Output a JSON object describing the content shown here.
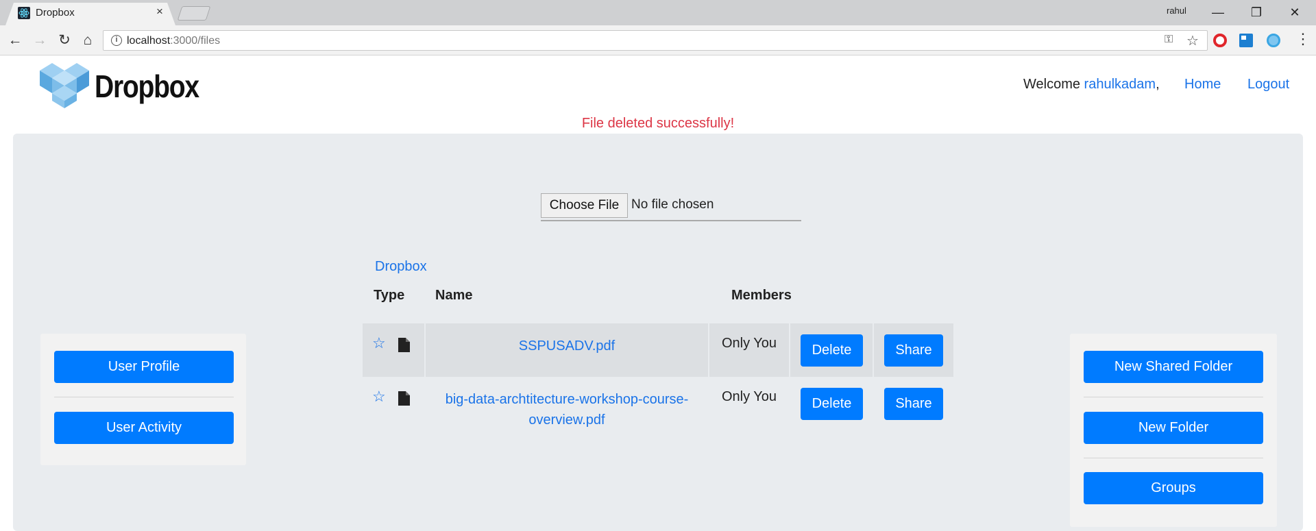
{
  "browser": {
    "tab_title": "Dropbox",
    "tab_close": "×",
    "window_user": "rahul",
    "window_controls": {
      "minimize": "—",
      "restore": "❐",
      "close": "✕"
    },
    "nav": {
      "back": "←",
      "forward": "→",
      "reload": "↻",
      "home": "⌂"
    },
    "url_host": "localhost",
    "url_path": ":3000/files",
    "info_glyph": "i",
    "key_glyph": "⚿",
    "star_glyph": "☆",
    "menu_glyph": "⋮"
  },
  "header": {
    "logo_text": "Dropbox",
    "welcome_prefix": "Welcome ",
    "username": "rahulkadam",
    "welcome_suffix": ",",
    "home_link": "Home",
    "logout_link": "Logout"
  },
  "flash_message": "File deleted successfully!",
  "upload": {
    "choose_label": "Choose File",
    "status": "No file chosen"
  },
  "left_panel": {
    "buttons": [
      "User Profile",
      "User Activity"
    ]
  },
  "right_panel": {
    "buttons": [
      "New Shared Folder",
      "New Folder",
      "Groups"
    ]
  },
  "breadcrumb": "Dropbox",
  "table": {
    "headers": {
      "type": "Type",
      "name": "Name",
      "members": "Members"
    },
    "rows": [
      {
        "name": "SSPUSADV.pdf",
        "members": "Only You",
        "delete": "Delete",
        "share": "Share",
        "star": "☆"
      },
      {
        "name": "big-data-archtitecture-workshop-course-overview.pdf",
        "members": "Only You",
        "delete": "Delete",
        "share": "Share",
        "star": "☆"
      }
    ]
  },
  "colors": {
    "primary": "#007bff",
    "link": "#1a73e8",
    "danger": "#dc3545",
    "jumbotron": "#e9ecef"
  }
}
